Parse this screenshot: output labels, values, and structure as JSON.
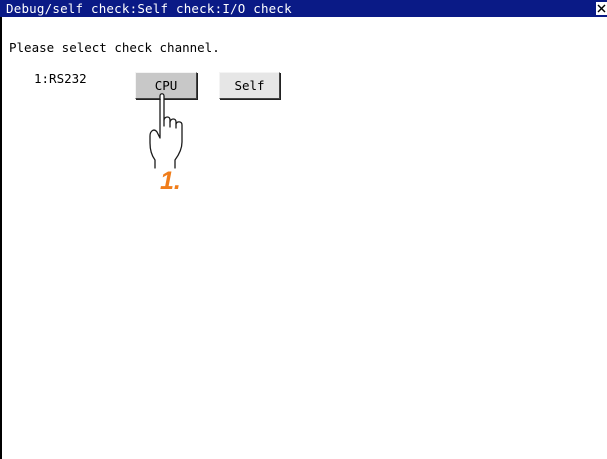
{
  "window": {
    "title": "Debug/self check:Self check:I/O check",
    "close_icon": "close-x-icon"
  },
  "main": {
    "instruction": "Please select check channel.",
    "channel_label": "1:RS232",
    "buttons": [
      {
        "label": "CPU",
        "state": "pressed"
      },
      {
        "label": "Self",
        "state": "normal"
      }
    ]
  },
  "annotation": {
    "step_number": "1.",
    "pointer_icon": "pointing-hand-icon"
  },
  "colors": {
    "titlebar_bg": "#0a1a86",
    "titlebar_text": "#ffffff",
    "button_face": "#e6e6e6",
    "button_pressed": "#c8c8c8",
    "step_marker": "#f07d1a"
  }
}
